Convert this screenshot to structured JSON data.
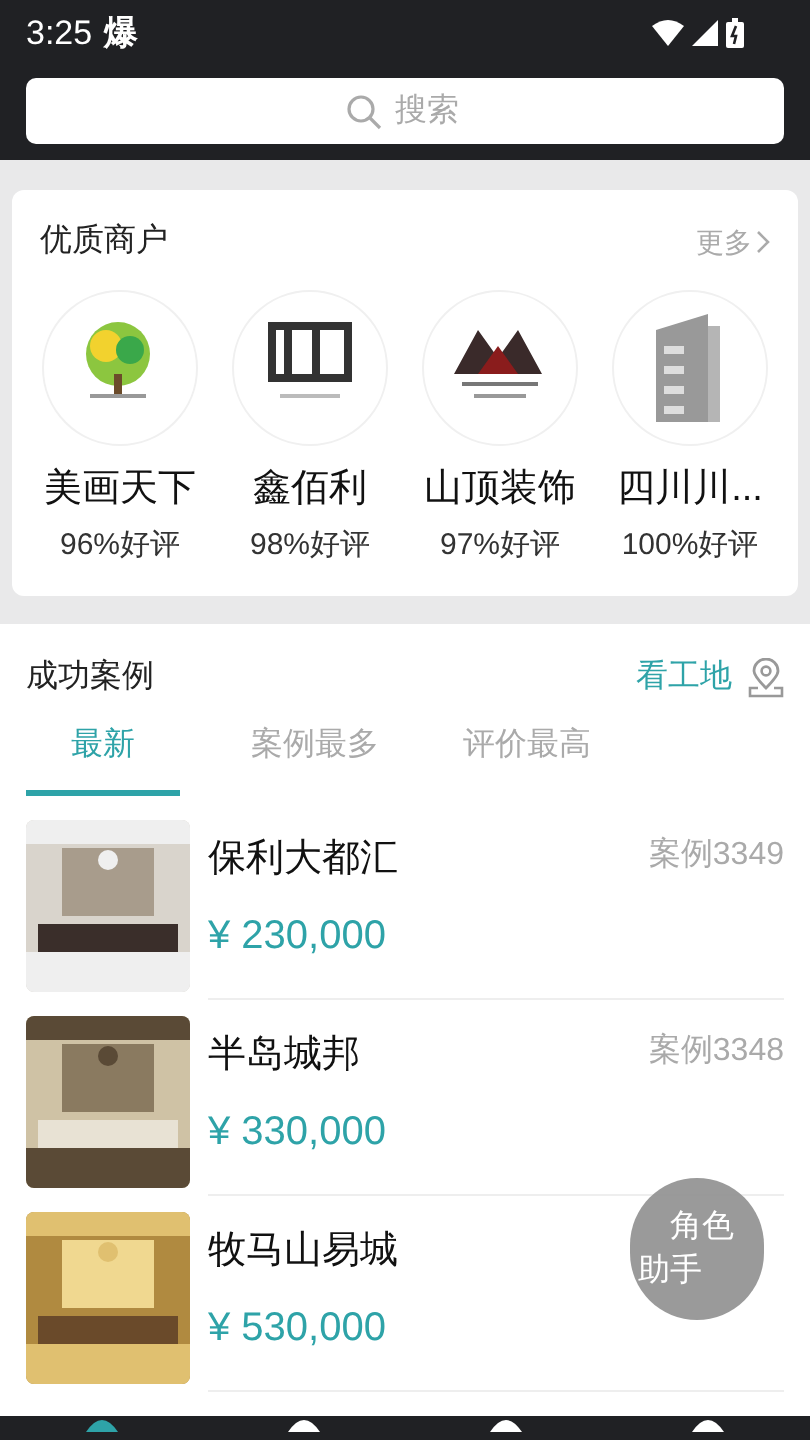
{
  "status_bar": {
    "time": "3:25",
    "notice": "爆"
  },
  "search": {
    "placeholder": "搜索"
  },
  "merchants": {
    "title": "优质商户",
    "more": "更多",
    "items": [
      {
        "name": "美画天下",
        "rating": "96%好评",
        "kind": "tree"
      },
      {
        "name": "鑫佰利",
        "rating": "98%好评",
        "kind": "blocks"
      },
      {
        "name": "山顶装饰",
        "rating": "97%好评",
        "kind": "mountain"
      },
      {
        "name": "四川川...",
        "rating": "100%好评",
        "kind": "building"
      }
    ]
  },
  "cases": {
    "title": "成功案例",
    "site_link": "看工地",
    "tabs": [
      {
        "label": "最新",
        "selected": true
      },
      {
        "label": "案例最多",
        "selected": false
      },
      {
        "label": "评价最高",
        "selected": false
      }
    ],
    "items": [
      {
        "name": "保利大都汇",
        "price": "¥ 230,000",
        "tag": "案例3349",
        "kind": "grey"
      },
      {
        "name": "半岛城邦",
        "price": "¥ 330,000",
        "tag": "案例3348",
        "kind": "beige"
      },
      {
        "name": "牧马山易城",
        "price": "¥ 530,000",
        "kind": "gold"
      }
    ]
  },
  "assistant": {
    "line1": "角色",
    "line2": "助手"
  },
  "bottom_nav": [
    {
      "selected": true
    },
    {
      "selected": false
    },
    {
      "selected": false
    },
    {
      "selected": false
    }
  ]
}
